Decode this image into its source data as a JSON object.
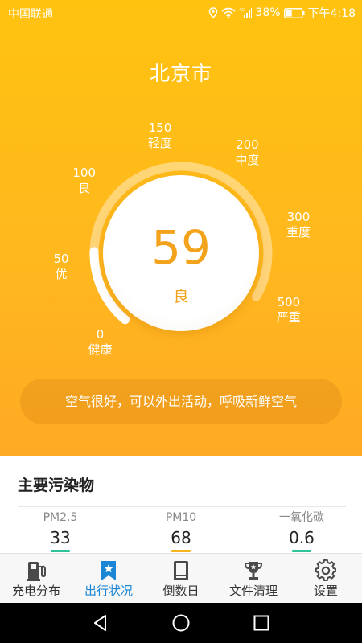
{
  "status_bar": {
    "carrier": "中国联通",
    "network_tag": "4G",
    "battery": "38%",
    "time": "下午4:18"
  },
  "city": "北京市",
  "aqi": {
    "value": 59,
    "level": "良",
    "scale_max": 500,
    "scale": [
      {
        "value": "0",
        "label": "健康"
      },
      {
        "value": "50",
        "label": "优"
      },
      {
        "value": "100",
        "label": "良"
      },
      {
        "value": "150",
        "label": "轻度"
      },
      {
        "value": "200",
        "label": "中度"
      },
      {
        "value": "300",
        "label": "重度"
      },
      {
        "value": "500",
        "label": "严重"
      }
    ]
  },
  "advice": "空气很好，可以外出活动，呼吸新鲜空气",
  "pollutants": {
    "title": "主要污染物",
    "items": [
      {
        "name": "PM2.5",
        "value": "33",
        "color": "#2fc39a"
      },
      {
        "name": "PM10",
        "value": "68",
        "color": "#f7b51d"
      },
      {
        "name": "一氧化碳",
        "value": "0.6",
        "color": "#2fc39a"
      }
    ]
  },
  "tabs": [
    {
      "label": "充电分布",
      "icon": "charging-station-icon",
      "active": false
    },
    {
      "label": "出行状况",
      "icon": "bookmark-star-icon",
      "active": true
    },
    {
      "label": "倒数日",
      "icon": "book-icon",
      "active": false
    },
    {
      "label": "文件清理",
      "icon": "trophy-icon",
      "active": false
    },
    {
      "label": "设置",
      "icon": "gear-icon",
      "active": false
    }
  ],
  "colors": {
    "accent": "#1b86d6",
    "hero_top": "#ffc30f",
    "hero_bottom": "#ffaa24",
    "aqi_text": "#f3a21b"
  }
}
